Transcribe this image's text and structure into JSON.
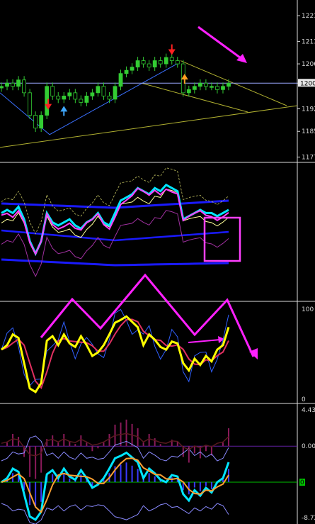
{
  "chart_data": [
    {
      "type": "candlestick",
      "panel": "price",
      "y_tick_labels": [
        "1221",
        "1213",
        "1206",
        "1200",
        "1192",
        "1185",
        "1177"
      ],
      "y_ticks": [
        1221,
        1213,
        1206,
        1200,
        1192,
        1185,
        1177
      ],
      "ylim": [
        1176,
        1225
      ],
      "current_price_label": "1200",
      "current_price": 1200,
      "close_path": [
        1199,
        1200,
        1199,
        1201,
        1197,
        1190,
        1186,
        1190,
        1199,
        1196,
        1195,
        1196,
        1197,
        1195,
        1194,
        1196,
        1197,
        1199,
        1196,
        1195,
        1199,
        1203,
        1204,
        1205,
        1207,
        1206,
        1205,
        1207,
        1206,
        1208,
        1207,
        1206,
        1197,
        1198,
        1199,
        1200,
        1199,
        1199,
        1198,
        1199,
        1200
      ],
      "arrows": [
        {
          "kind": "sell",
          "color": "#ff2020"
        },
        {
          "kind": "buy",
          "color": "#40a8ff"
        },
        {
          "kind": "sell",
          "color": "#ff2020"
        },
        {
          "kind": "buy",
          "color": "#ffa020"
        }
      ]
    },
    {
      "type": "line",
      "panel": "bands",
      "series": [
        {
          "color": "#1a1aff",
          "role": "upper-band"
        },
        {
          "color": "#1a1aff",
          "role": "middle-band"
        },
        {
          "color": "#1a1aff",
          "role": "lower-band"
        },
        {
          "color": "#00e5ff",
          "role": "fast"
        },
        {
          "color": "#ff40ff",
          "role": "slow"
        },
        {
          "color": "#ffff66",
          "role": "signal"
        }
      ]
    },
    {
      "type": "line",
      "panel": "stochastic",
      "y_tick_labels": [
        "100",
        "0"
      ],
      "y_ticks": [
        100,
        0
      ],
      "ylim": [
        0,
        100
      ],
      "series": [
        {
          "color": "#ffff00",
          "role": "main",
          "values": [
            55,
            60,
            72,
            68,
            40,
            12,
            8,
            18,
            65,
            70,
            60,
            72,
            62,
            58,
            70,
            60,
            48,
            52,
            60,
            72,
            85,
            88,
            92,
            86,
            80,
            60,
            72,
            66,
            58,
            55,
            64,
            62,
            40,
            32,
            45,
            38,
            48,
            42,
            55,
            60,
            80
          ]
        },
        {
          "color": "#e03060",
          "role": "signal"
        },
        {
          "color": "#3060ff",
          "role": "thin"
        }
      ]
    },
    {
      "type": "bar",
      "panel": "oscillator",
      "y_tick_labels": [
        "4.43",
        "0.00",
        "-8.72"
      ],
      "y_ticks": [
        4.43,
        0.0,
        -8.72
      ],
      "ylim": [
        -8.72,
        4.43
      ],
      "level_marker_label": "0",
      "series": [
        {
          "color": "#3a3aff",
          "role": "histogram"
        },
        {
          "color": "#00e5ff",
          "role": "line"
        },
        {
          "color": "#ffa030",
          "role": "line"
        }
      ]
    }
  ],
  "annotations": {
    "arrow_color": "#ff20ff",
    "box_color": "#ff40ff"
  },
  "colors": {
    "background": "#000000",
    "separator": "#dddddd",
    "bull_candle": "#33cc33",
    "trendline_yellow": "#b0b030",
    "trendline_blue": "#3a70ff",
    "zero_line_green": "#00c000",
    "zero_line_purple": "#6020a0"
  }
}
